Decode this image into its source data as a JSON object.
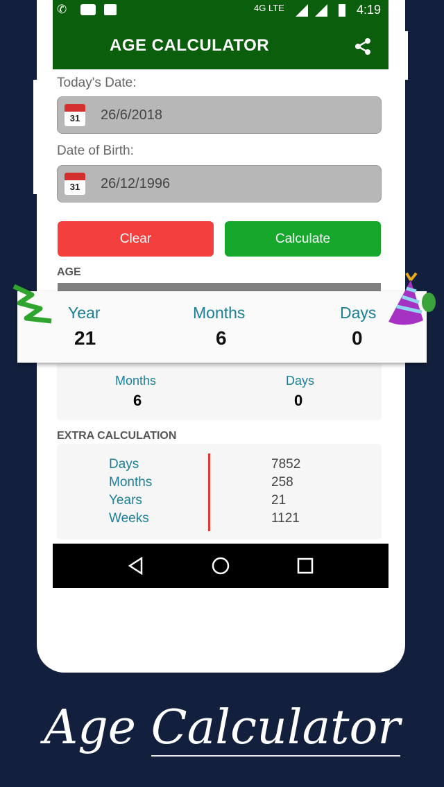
{
  "status_bar": {
    "time": "4:19",
    "network": "4G LTE",
    "icons": [
      "whatsapp-icon",
      "youtube-icon",
      "gallery-icon",
      "call-icon",
      "signal-icon",
      "battery-icon"
    ]
  },
  "header": {
    "title": "AGE CALCULATOR",
    "share_icon": "share-icon",
    "color": "#0b5e0b"
  },
  "form": {
    "today_label": "Today's Date:",
    "today_value": "26/6/2018",
    "dob_label": "Date of Birth:",
    "dob_value": "26/12/1996",
    "calendar_icon_text": "31"
  },
  "buttons": {
    "clear": "Clear",
    "calculate": "Calculate"
  },
  "age": {
    "section": "AGE",
    "year_label": "Year",
    "year": "21",
    "months_label": "Months",
    "months": "6",
    "days_label": "Days",
    "days": "0"
  },
  "extra": {
    "section": "EXTRA CALCULATION",
    "rows": [
      {
        "label": "Days",
        "value": "7852"
      },
      {
        "label": "Months",
        "value": "258"
      },
      {
        "label": "Years",
        "value": "21"
      },
      {
        "label": "Weeks",
        "value": "1121"
      }
    ]
  },
  "promo_title": {
    "word1": "Age",
    "word2": "Calculator"
  }
}
